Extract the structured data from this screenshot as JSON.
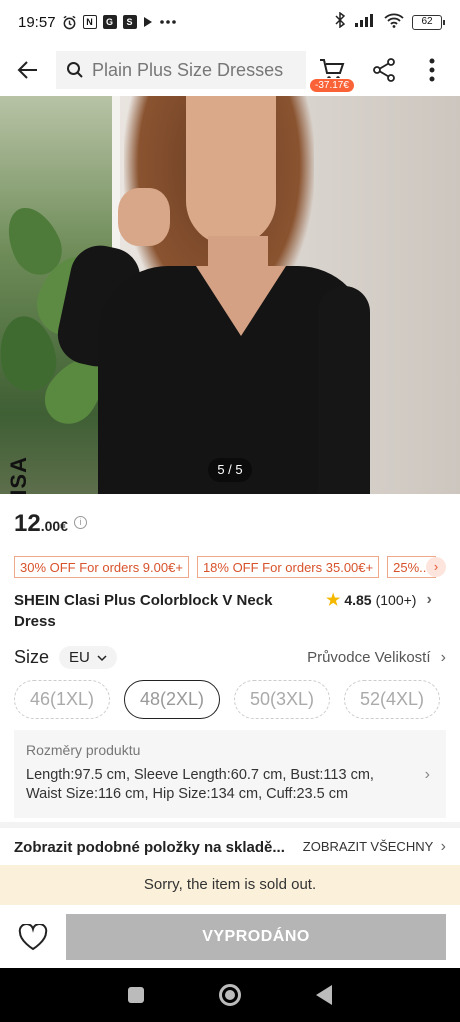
{
  "status_bar": {
    "time": "19:57",
    "icons_left": [
      "alarm-icon",
      "nfc-icon",
      "ge-icon",
      "s-icon",
      "play-icon",
      "more-dots"
    ],
    "battery": "62"
  },
  "header": {
    "search_placeholder": "Plain Plus Size Dresses",
    "cart_badge": "-37.17€"
  },
  "gallery": {
    "counter": "5 / 5",
    "brand_vertical_text": "ISA"
  },
  "product": {
    "price_int": "12",
    "price_dec": ".00€",
    "coupons": [
      "30% OFF For orders 9.00€+",
      "18% OFF For orders 35.00€+",
      "25%..."
    ],
    "title": "SHEIN Clasi Plus Colorblock V Neck Dress",
    "rating": "4.85",
    "rating_count": "(100+)"
  },
  "size": {
    "label": "Size",
    "unit": "EU",
    "guide": "Průvodce Velikostí",
    "options": [
      "46(1XL)",
      "48(2XL)",
      "50(3XL)",
      "52(4XL)"
    ],
    "selected_index": 1
  },
  "spec": {
    "title": "Rozměry produktu",
    "text": "Length:97.5 cm, Sleeve Length:60.7 cm, Bust:113 cm, Waist Size:116 cm, Hip Size:134 cm, Cuff:23.5 cm"
  },
  "similar": {
    "text": "Zobrazit podobné položky na skladě...",
    "all": "ZOBRAZIT VŠECHNY"
  },
  "soldout_notice": "Sorry, the item is sold out.",
  "bottom": {
    "buy_label": "VYPRODÁNO"
  },
  "colors": {
    "accent": "#fa6338",
    "coupon_text": "#d8532c",
    "soldout_bg": "#fbf1da",
    "disabled_button": "#b5b5b5",
    "star": "#f5b800"
  }
}
